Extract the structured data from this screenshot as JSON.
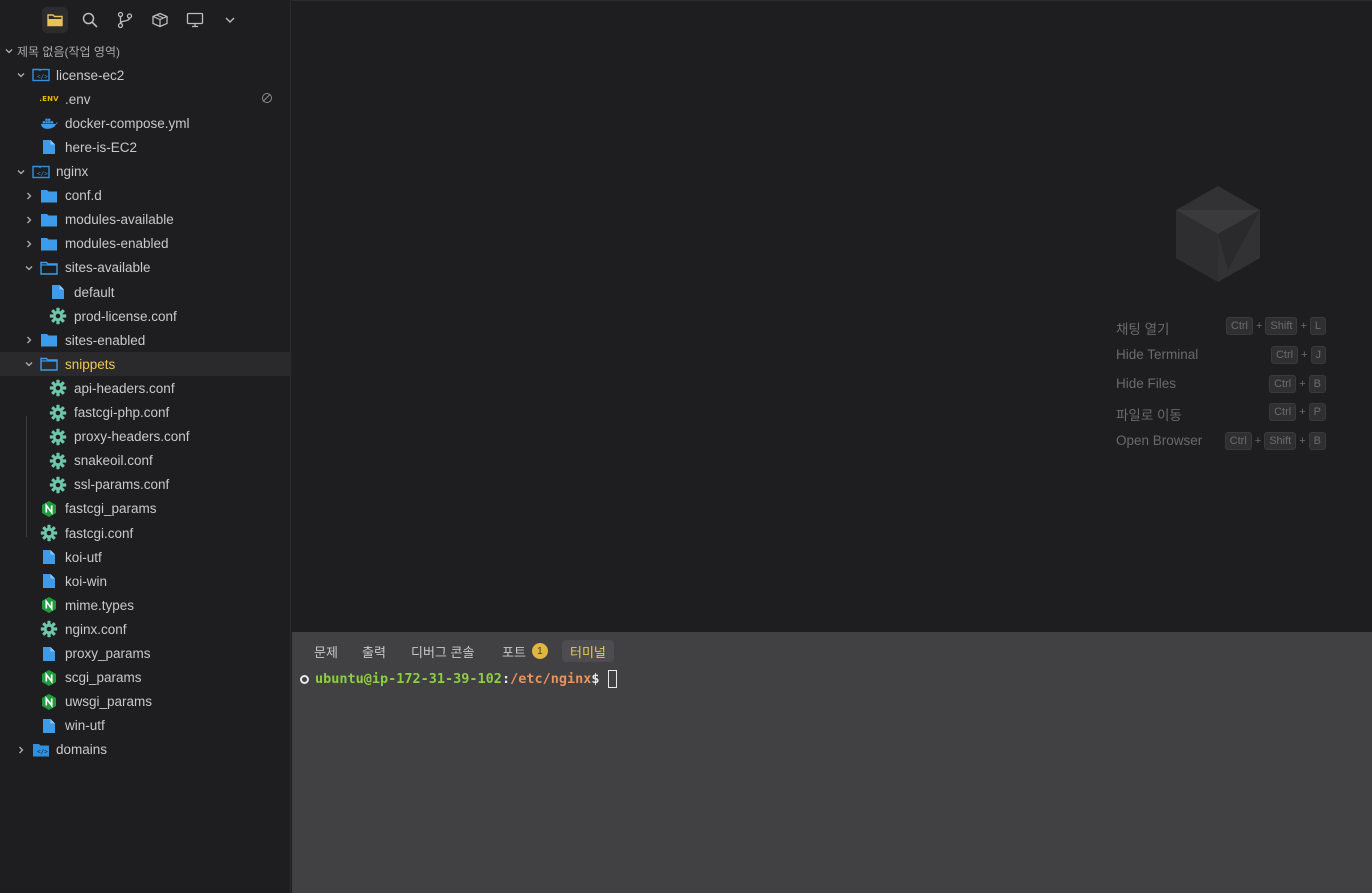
{
  "activity_bar": [
    {
      "icon": "folder-icon",
      "active": true
    },
    {
      "icon": "search-icon",
      "active": false
    },
    {
      "icon": "source-control-icon",
      "active": false
    },
    {
      "icon": "package-icon",
      "active": false
    },
    {
      "icon": "monitor-icon",
      "active": false
    },
    {
      "icon": "chevron-down-icon",
      "active": false
    }
  ],
  "explorer": {
    "root_label": "제목 없음(작업 영역)",
    "items": [
      {
        "label": "license-ec2",
        "type": "root-folder",
        "expanded": true
      },
      {
        "label": ".env",
        "type": "env",
        "env_badge": ".ENV"
      },
      {
        "label": "docker-compose.yml",
        "type": "docker"
      },
      {
        "label": "here-is-EC2",
        "type": "file"
      },
      {
        "label": "nginx",
        "type": "root-folder",
        "expanded": true
      },
      {
        "label": "conf.d",
        "type": "folder",
        "expanded": false
      },
      {
        "label": "modules-available",
        "type": "folder",
        "expanded": false
      },
      {
        "label": "modules-enabled",
        "type": "folder",
        "expanded": false
      },
      {
        "label": "sites-available",
        "type": "folder",
        "expanded": true
      },
      {
        "label": "default",
        "type": "file"
      },
      {
        "label": "prod-license.conf",
        "type": "gear"
      },
      {
        "label": "sites-enabled",
        "type": "folder",
        "expanded": false
      },
      {
        "label": "snippets",
        "type": "folder",
        "expanded": true,
        "selected": true
      },
      {
        "label": "api-headers.conf",
        "type": "gear"
      },
      {
        "label": "fastcgi-php.conf",
        "type": "gear"
      },
      {
        "label": "proxy-headers.conf",
        "type": "gear"
      },
      {
        "label": "snakeoil.conf",
        "type": "gear"
      },
      {
        "label": "ssl-params.conf",
        "type": "gear"
      },
      {
        "label": "fastcgi_params",
        "type": "nginx"
      },
      {
        "label": "fastcgi.conf",
        "type": "gear"
      },
      {
        "label": "koi-utf",
        "type": "file"
      },
      {
        "label": "koi-win",
        "type": "file"
      },
      {
        "label": "mime.types",
        "type": "nginx"
      },
      {
        "label": "nginx.conf",
        "type": "gear"
      },
      {
        "label": "proxy_params",
        "type": "file"
      },
      {
        "label": "scgi_params",
        "type": "nginx"
      },
      {
        "label": "uwsgi_params",
        "type": "nginx"
      },
      {
        "label": "win-utf",
        "type": "file"
      },
      {
        "label": "domains",
        "type": "root-folder-filled",
        "expanded": false
      }
    ]
  },
  "shortcuts": [
    {
      "label": "채팅 열기",
      "keys": [
        "Ctrl",
        "Shift",
        "L"
      ]
    },
    {
      "label": "Hide Terminal",
      "keys": [
        "Ctrl",
        "J"
      ]
    },
    {
      "label": "Hide Files",
      "keys": [
        "Ctrl",
        "B"
      ]
    },
    {
      "label": "파일로 이동",
      "keys": [
        "Ctrl",
        "P"
      ]
    },
    {
      "label": "Open Browser",
      "keys": [
        "Ctrl",
        "Shift",
        "B"
      ]
    }
  ],
  "panel": {
    "tabs": [
      {
        "label": "문제",
        "active": false
      },
      {
        "label": "출력",
        "active": false
      },
      {
        "label": "디버그 콘솔",
        "active": false
      },
      {
        "label": "포트",
        "active": false,
        "badge": "1"
      },
      {
        "label": "터미널",
        "active": true
      }
    ],
    "terminal": {
      "user_host": "ubuntu@ip-172-31-39-102",
      "colon": ":",
      "path": "/etc/nginx",
      "prompt": "$"
    }
  },
  "colors": {
    "accent_yellow": "#f0c94b",
    "folder_blue": "#3d9be9",
    "gear_green": "#6fc6a8",
    "nginx_green": "#1f9b3c",
    "terminal_user": "#8ccf3f",
    "terminal_path": "#e8925c"
  }
}
